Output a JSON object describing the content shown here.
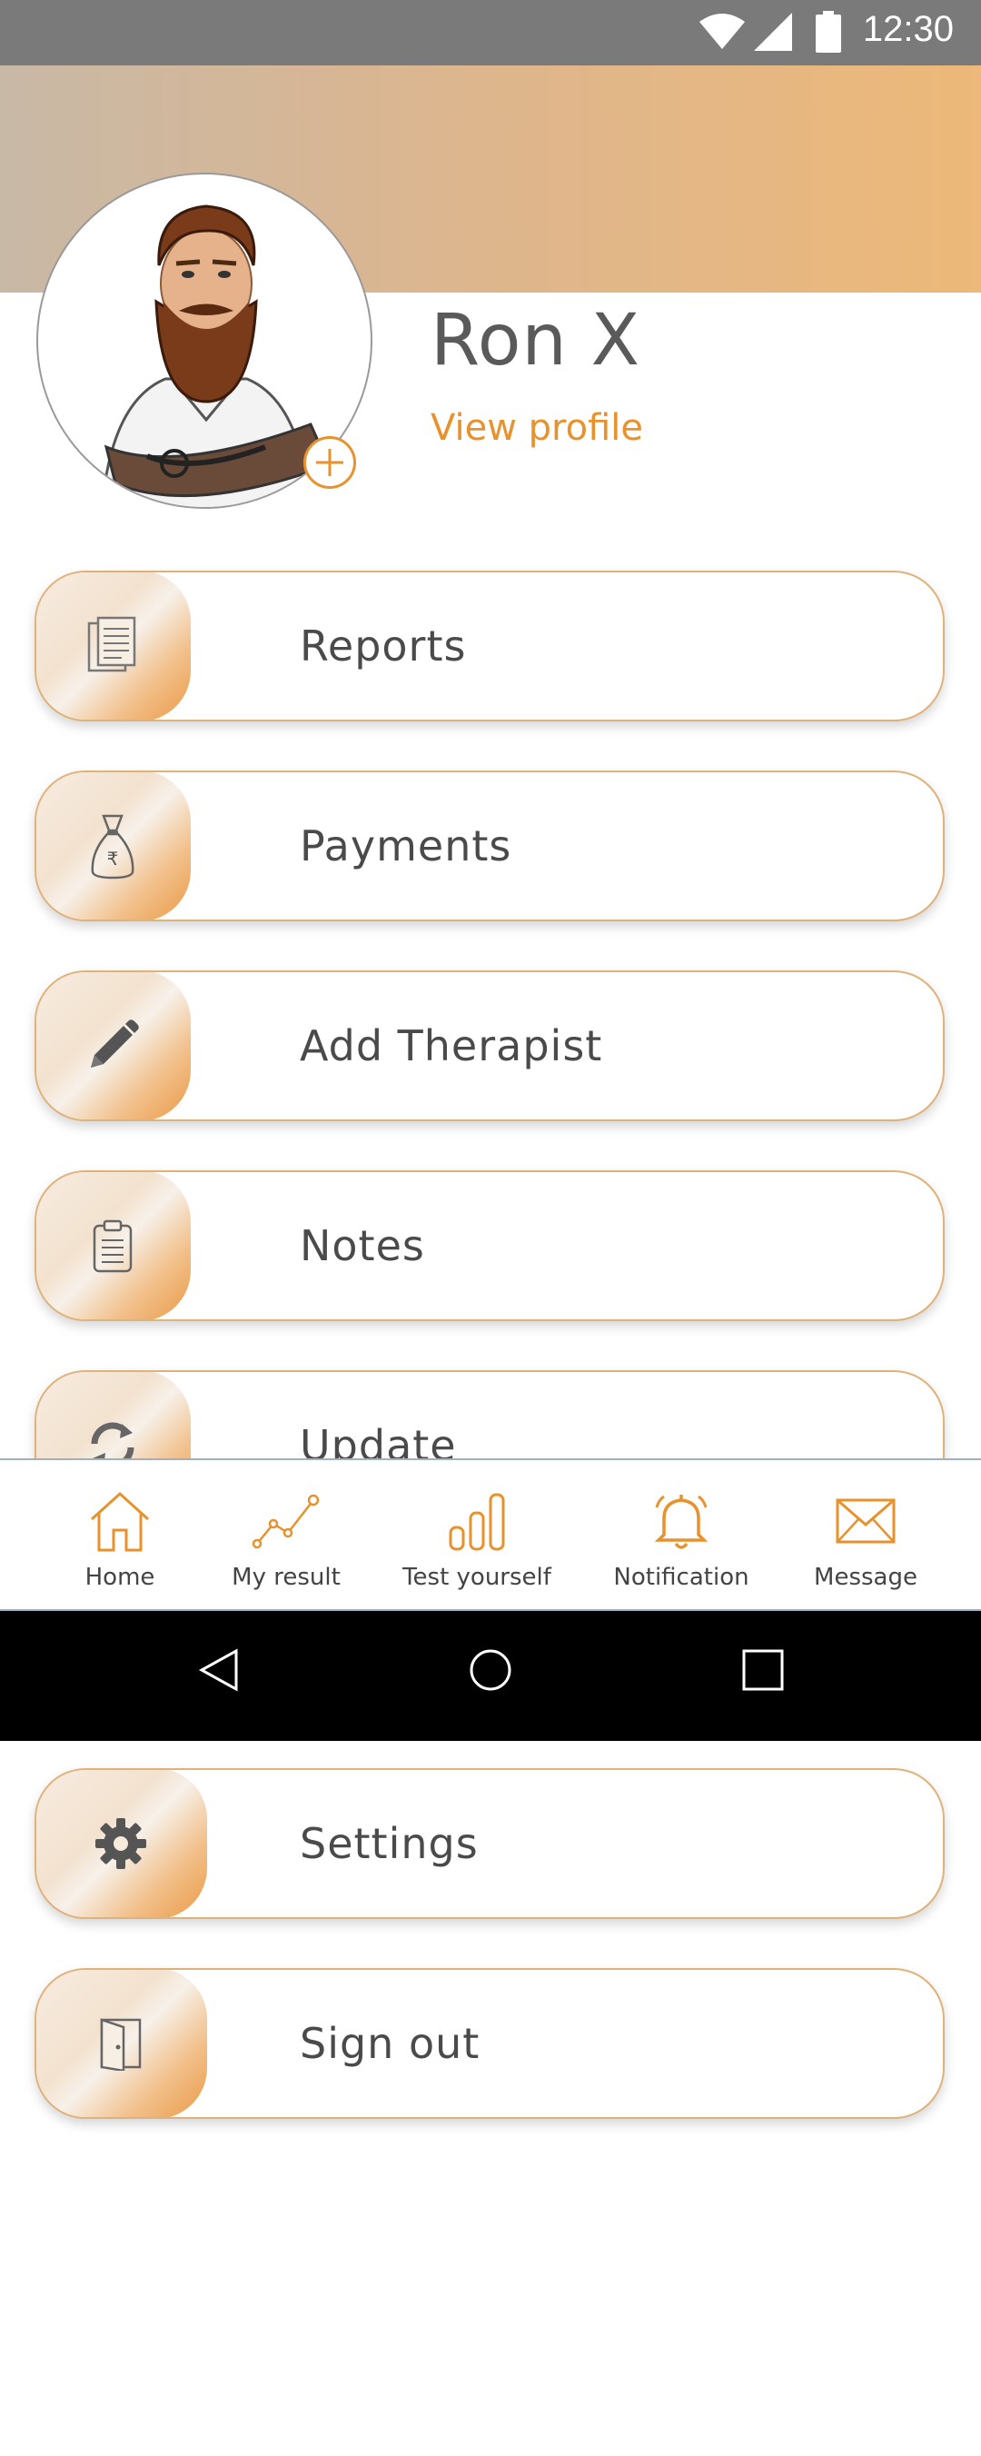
{
  "status_bar": {
    "time": "12:30",
    "icons": [
      "wifi-icon",
      "signal-icon",
      "battery-icon"
    ]
  },
  "colors": {
    "accent": "#e8922e",
    "header_gradient_start": "#c8b8a6",
    "header_gradient_end": "#edb879",
    "card_border": "#e0b27a"
  },
  "profile": {
    "name": "Ron X",
    "view_profile_label": "View profile",
    "avatar_icon": "avatar-illustration",
    "add_photo_icon": "plus-icon"
  },
  "menu": {
    "items": [
      {
        "label": "Reports",
        "icon": "reports-document-icon"
      },
      {
        "label": "Payments",
        "icon": "money-bag-rupee-icon"
      },
      {
        "label": "Add Therapist",
        "icon": "pencil-icon"
      },
      {
        "label": "Notes",
        "icon": "clipboard-icon"
      },
      {
        "label": "Update",
        "icon": "refresh-icon"
      },
      {
        "label": "Settings",
        "icon": "gear-icon"
      },
      {
        "label": "Sign out",
        "icon": "door-exit-icon"
      }
    ]
  },
  "bottom_nav": {
    "items": [
      {
        "label": "Home",
        "icon": "home-icon"
      },
      {
        "label": "My result",
        "icon": "line-graph-icon"
      },
      {
        "label": "Test yourself",
        "icon": "bar-chart-icon"
      },
      {
        "label": "Notification",
        "icon": "bell-icon"
      },
      {
        "label": "Message",
        "icon": "envelope-icon"
      }
    ]
  },
  "system_nav": {
    "buttons": [
      "back-triangle-icon",
      "home-circle-icon",
      "recents-square-icon"
    ]
  }
}
